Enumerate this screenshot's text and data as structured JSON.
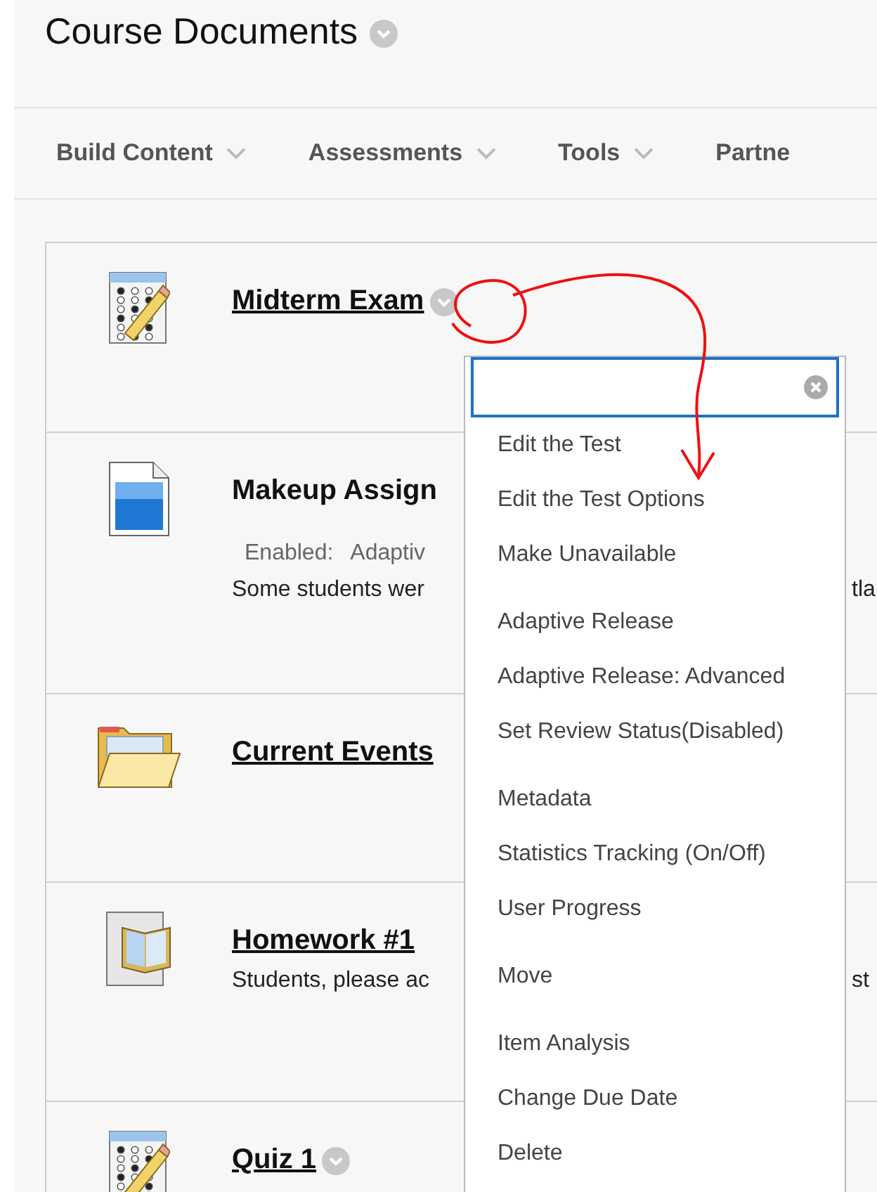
{
  "page": {
    "title": "Course Documents"
  },
  "toolbar": [
    {
      "label": "Build Content",
      "has_caret": true
    },
    {
      "label": "Assessments",
      "has_caret": true
    },
    {
      "label": "Tools",
      "has_caret": true
    },
    {
      "label": "Partne",
      "has_caret": false
    }
  ],
  "items": [
    {
      "kind": "test",
      "title": "Midterm Exam",
      "has_menu_button": true
    },
    {
      "kind": "assignment",
      "title": "Makeup Assign",
      "has_menu_button": false,
      "lines": [
        {
          "kind": "status",
          "parts": [
            "Enabled:",
            "Adaptiv"
          ]
        },
        {
          "kind": "text",
          "parts": [
            "Some students wer"
          ],
          "tail": "tla"
        }
      ]
    },
    {
      "kind": "folder",
      "title": "Current Events",
      "has_menu_button": false
    },
    {
      "kind": "module",
      "title": "Homework #1",
      "has_menu_button": false,
      "lines": [
        {
          "kind": "text",
          "parts": [
            "Students, please ac"
          ],
          "tail": "st"
        }
      ]
    },
    {
      "kind": "test",
      "title": "Quiz 1",
      "has_menu_button": true
    }
  ],
  "context_menu": {
    "groups": [
      [
        "Edit the Test",
        "Edit the Test Options",
        "Make Unavailable"
      ],
      [
        "Adaptive Release",
        "Adaptive Release: Advanced",
        "Set Review Status(Disabled)"
      ],
      [
        "Metadata",
        "Statistics Tracking (On/Off)",
        "User Progress"
      ],
      [
        "Move"
      ],
      [
        "Item Analysis",
        "Change Due Date",
        "Delete"
      ]
    ]
  }
}
